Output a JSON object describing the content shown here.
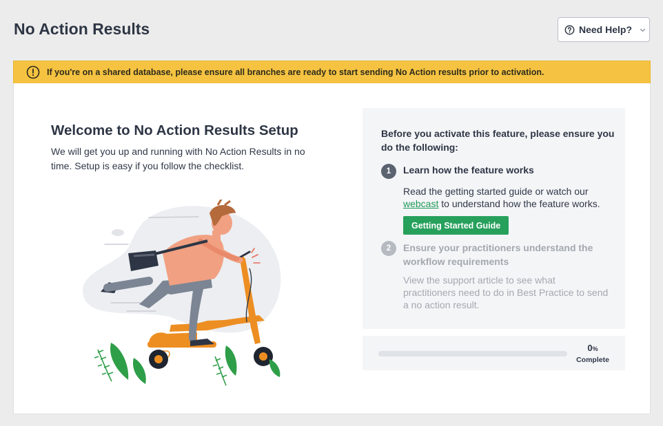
{
  "header": {
    "title": "No Action Results",
    "help_label": "Need Help?"
  },
  "warning": {
    "text": "If you're on a shared database, please ensure all branches are ready to start sending No Action results prior to activation."
  },
  "welcome": {
    "title": "Welcome to No Action Results Setup",
    "description": "We will get you up and running with No Action Results in no time. Setup is easy if you follow the checklist."
  },
  "checklist": {
    "intro": "Before you activate this feature, please ensure you do the following:",
    "steps": [
      {
        "number": "1",
        "title": "Learn how the feature works",
        "desc_before": "Read the getting started guide or watch our ",
        "link_text": "webcast",
        "desc_after": " to understand how the feature works.",
        "button_label": "Getting Started Guide",
        "state": "active"
      },
      {
        "number": "2",
        "title": "Ensure your practitioners understand the workflow requirements",
        "description": "View the support article to see what practitioners need to do in Best Practice to send a no action result.",
        "state": "inactive"
      }
    ]
  },
  "progress": {
    "value": "0",
    "unit": "%",
    "label": "Complete",
    "fraction": 0
  },
  "colors": {
    "accent_green": "#27a05c",
    "warning_yellow": "#f5c341",
    "inactive_text": "#a3a8b0"
  }
}
